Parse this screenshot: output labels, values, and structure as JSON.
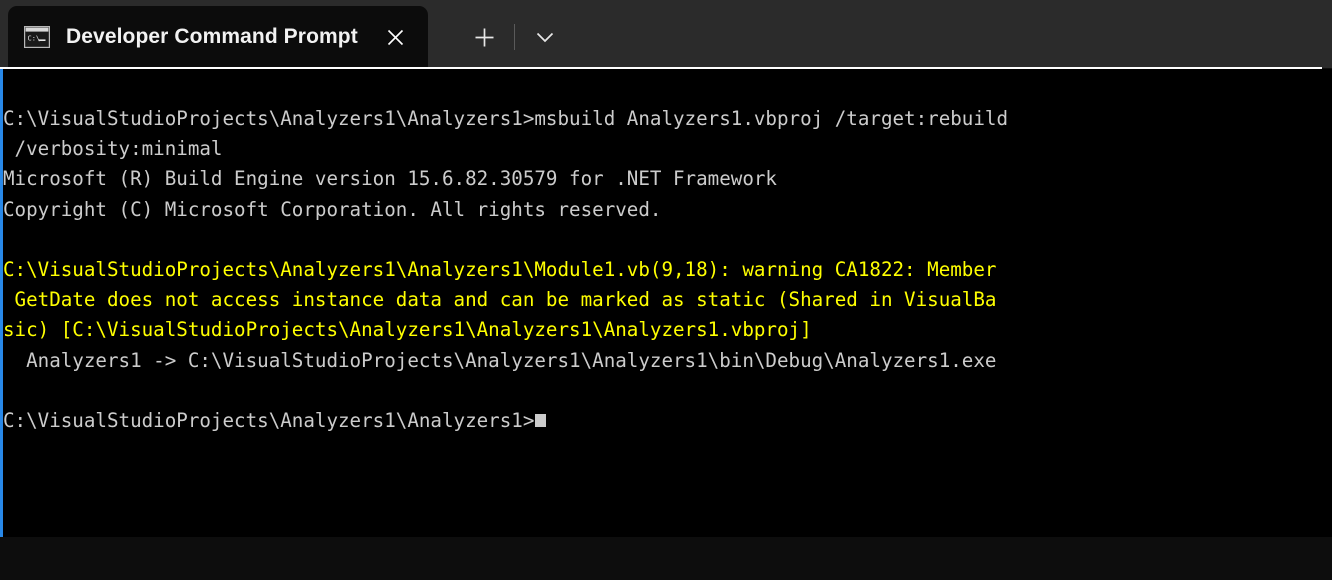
{
  "window": {
    "background": "#0d0d0d",
    "tabstrip_bg": "#2b2b2b",
    "pane_bg": "#000000",
    "accent_color": "#2888e8"
  },
  "tabbar": {
    "tab": {
      "icon": "command-prompt-icon",
      "title": "Developer Command Prompt",
      "close_label": "✕"
    },
    "new_tab_label": "+",
    "dropdown_label": "⌄"
  },
  "terminal": {
    "foreground": "#cccccc",
    "warning_color": "#ffff00",
    "cursor": "block",
    "lines": [
      {
        "text": "C:\\VisualStudioProjects\\Analyzers1\\Analyzers1>msbuild Analyzers1.vbproj /target:rebuild",
        "style": "normal"
      },
      {
        "text": " /verbosity:minimal",
        "style": "normal"
      },
      {
        "text": "Microsoft (R) Build Engine version 15.6.82.30579 for .NET Framework",
        "style": "normal"
      },
      {
        "text": "Copyright (C) Microsoft Corporation. All rights reserved.",
        "style": "normal"
      },
      {
        "text": "",
        "style": "blank"
      },
      {
        "text": "C:\\VisualStudioProjects\\Analyzers1\\Analyzers1\\Module1.vb(9,18): warning CA1822: Member",
        "style": "warn"
      },
      {
        "text": " GetDate does not access instance data and can be marked as static (Shared in VisualBa",
        "style": "warn"
      },
      {
        "text": "sic) [C:\\VisualStudioProjects\\Analyzers1\\Analyzers1\\Analyzers1.vbproj]",
        "style": "warn"
      },
      {
        "text": "  Analyzers1 -> C:\\VisualStudioProjects\\Analyzers1\\Analyzers1\\bin\\Debug\\Analyzers1.exe",
        "style": "normal"
      },
      {
        "text": "",
        "style": "blank"
      },
      {
        "text": "C:\\VisualStudioProjects\\Analyzers1\\Analyzers1>",
        "style": "prompt"
      }
    ]
  }
}
